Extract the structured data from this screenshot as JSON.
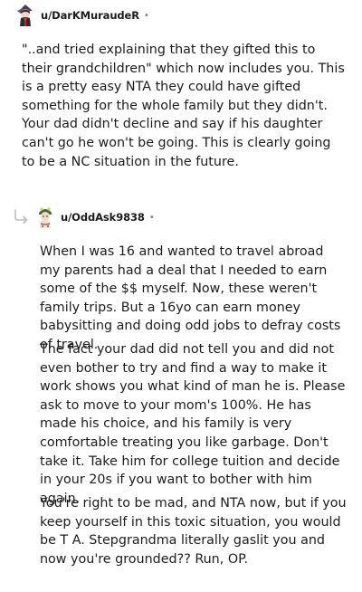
{
  "comment1": {
    "username": "u/DarKMuraudeR",
    "separator": "•",
    "body": "\"..and tried explaining that they gifted this to their grandchildren\" which now includes you. This is a pretty easy NTA they could have gifted something for the whole family but they didn't. Your dad didn't decline and say if his daughter can't go he won't be going. This is clearly going to be a NC situation in the future."
  },
  "comment2": {
    "username": "u/OddAsk9838",
    "separator": "•",
    "paragraphs": [
      "When I was 16 and wanted to travel abroad my parents had a deal that I needed to earn some of the $$ myself. Now, these weren't family trips. But a 16yo can earn money babysitting and doing odd jobs to defray costs of travel.",
      "The fact your dad did not tell you and did not even bother to try and find a way to make it work shows you what kind of man he is. Please ask to move to your mom's 100%. He has made his choice, and his family is very comfortable treating you like garbage. Don't take it. Take him for college tuition and decide in your 20s if you want to bother with him again.",
      "You're right to be mad, and NTA now, but if you keep yourself in this toxic situation, you would be T A. Stepgrandma literally gaslit you and now you're grounded?? Run, OP."
    ]
  },
  "icons": {
    "avatar1": "avatar-character-icon",
    "avatar2": "avatar-character-icon",
    "reply": "reply-arrow-icon"
  }
}
